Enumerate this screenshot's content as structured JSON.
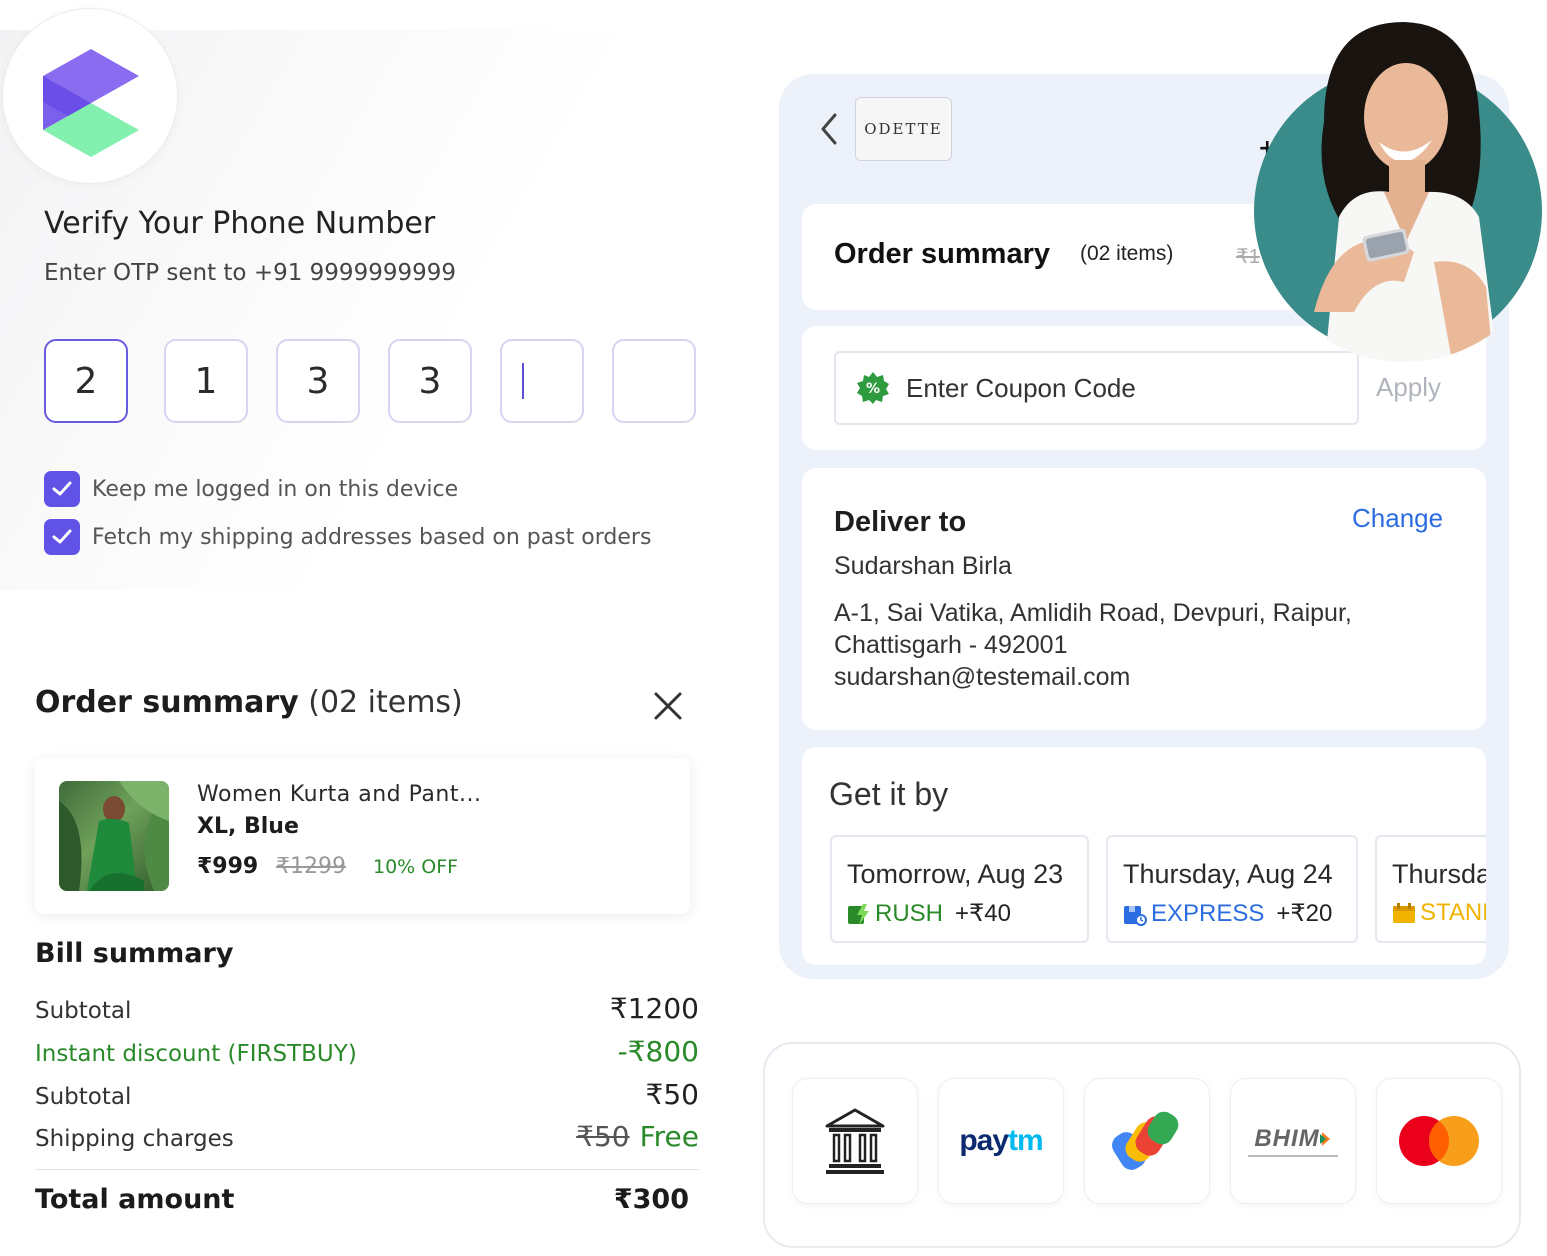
{
  "otp": {
    "title": "Verify Your Phone Number",
    "subtitle": "Enter OTP sent to +91 9999999999",
    "digits": [
      "2",
      "1",
      "3",
      "3",
      "",
      ""
    ],
    "checkbox_keep_logged": "Keep me logged in on this device",
    "checkbox_fetch_addresses": "Fetch my shipping addresses based on past orders",
    "accent_color": "#6152e6"
  },
  "order_summary": {
    "title": "Order summary",
    "count": "(02 items)",
    "item": {
      "name": "Women Kurta and Pant...",
      "variant": "XL, Blue",
      "price": "₹999",
      "mrp": "₹1299",
      "discount": "10% OFF"
    }
  },
  "bill": {
    "title": "Bill summary",
    "rows": [
      {
        "label": "Subtotal",
        "value": "₹1200"
      },
      {
        "label": "Instant discount (FIRSTBUY)",
        "value": "-₹800"
      },
      {
        "label": "Subtotal",
        "value": "₹50"
      },
      {
        "label": "Shipping charges",
        "value_strike": "₹50",
        "value": "Free"
      }
    ],
    "total_label": "Total amount",
    "total_value": "₹300"
  },
  "checkout": {
    "brand": "ODETTE",
    "order_title": "Order summary",
    "order_count": "(02 items)",
    "order_price_partial": "₹1",
    "coupon_placeholder": "Enter Coupon Code",
    "apply_label": "Apply",
    "deliver_title": "Deliver to",
    "change_label": "Change",
    "customer_name": "Sudarshan Birla",
    "address_line1": "A-1, Sai Vatika, Amlidih Road, Devpuri, Raipur,",
    "address_line2": "Chattisgarh - 492001",
    "email": "sudarshan@testemail.com",
    "getit_title": "Get it by",
    "slots": [
      {
        "date": "Tomorrow, Aug 23",
        "mode": "RUSH",
        "fee": "+₹40",
        "color": "#2a8a2a"
      },
      {
        "date": "Thursday, Aug 24",
        "mode": "EXPRESS",
        "fee": "+₹20",
        "color": "#2b6de0"
      },
      {
        "date": "Thursda",
        "mode": "STAND",
        "fee": "",
        "color": "#f0b400"
      }
    ]
  },
  "payments": {
    "methods": [
      "bank-icon",
      "paytm-logo",
      "gpay-logo",
      "bhim-logo",
      "mastercard-logo"
    ],
    "paytm_text_1": "pay",
    "paytm_text_2": "tm",
    "bhim_text": "BHIM"
  }
}
